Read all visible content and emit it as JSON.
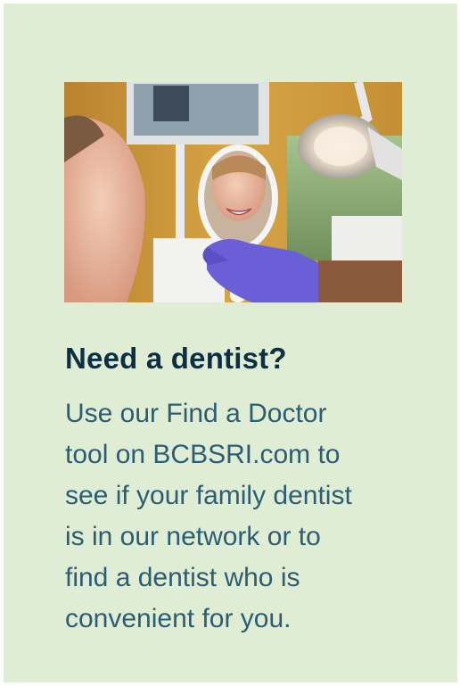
{
  "card": {
    "background": "#dfedd5",
    "image": {
      "subject": "woman smiling at her reflection in a dental hand mirror held by a gloved hand"
    },
    "heading": "Need a dentist?",
    "body_lines": [
      "Use our Find a Doctor",
      "tool on BCBSRI.com to",
      "see if your family dentist",
      "is in our network or to",
      "find a dentist who is",
      "convenient for you."
    ]
  },
  "colors": {
    "heading": "#0c2f43",
    "body": "#2d5d72",
    "glove": "#6a5fd6"
  }
}
